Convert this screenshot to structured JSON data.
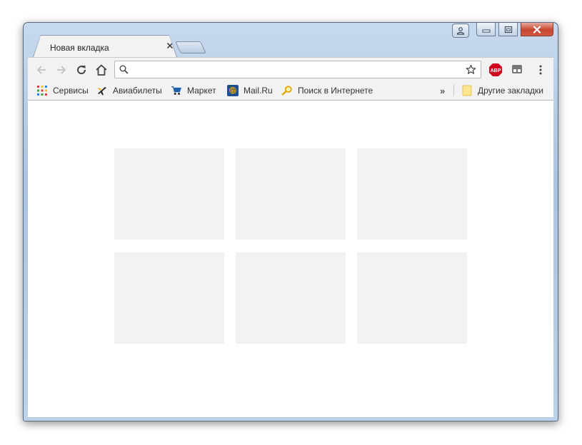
{
  "window": {
    "caption": {
      "profile_icon": "person-icon",
      "minimize_icon": "minimize-icon",
      "maximize_icon": "maximize-icon",
      "close_icon": "close-icon"
    }
  },
  "tabs": [
    {
      "title": "Новая вкладка",
      "active": true
    }
  ],
  "toolbar": {
    "back_icon": "arrow-left-icon",
    "forward_icon": "arrow-right-icon",
    "reload_icon": "reload-icon",
    "home_icon": "home-icon",
    "omnibox": {
      "value": "",
      "placeholder": ""
    },
    "bookmark_star_icon": "star-icon",
    "extensions": [
      "ABP",
      "extension-icon"
    ],
    "menu_icon": "kebab-menu-icon"
  },
  "bookmarks": {
    "items": [
      {
        "label": "Сервисы",
        "icon": "apps-grid-icon"
      },
      {
        "label": "Авиабилеты",
        "icon": "airplane-icon"
      },
      {
        "label": "Маркет",
        "icon": "cart-icon"
      },
      {
        "label": "Mail.Ru",
        "icon": "at-icon"
      },
      {
        "label": "Поиск в Интернете",
        "icon": "search-magnifier-icon"
      }
    ],
    "overflow_label": "»",
    "other": {
      "label": "Другие закладки",
      "icon": "folder-icon"
    }
  },
  "content": {
    "tile_count": 6
  },
  "colors": {
    "tile": "#f2f2f2",
    "toolbar": "#f2f2f2",
    "frame": "#a9c4e2",
    "abp": "#d0021b"
  }
}
